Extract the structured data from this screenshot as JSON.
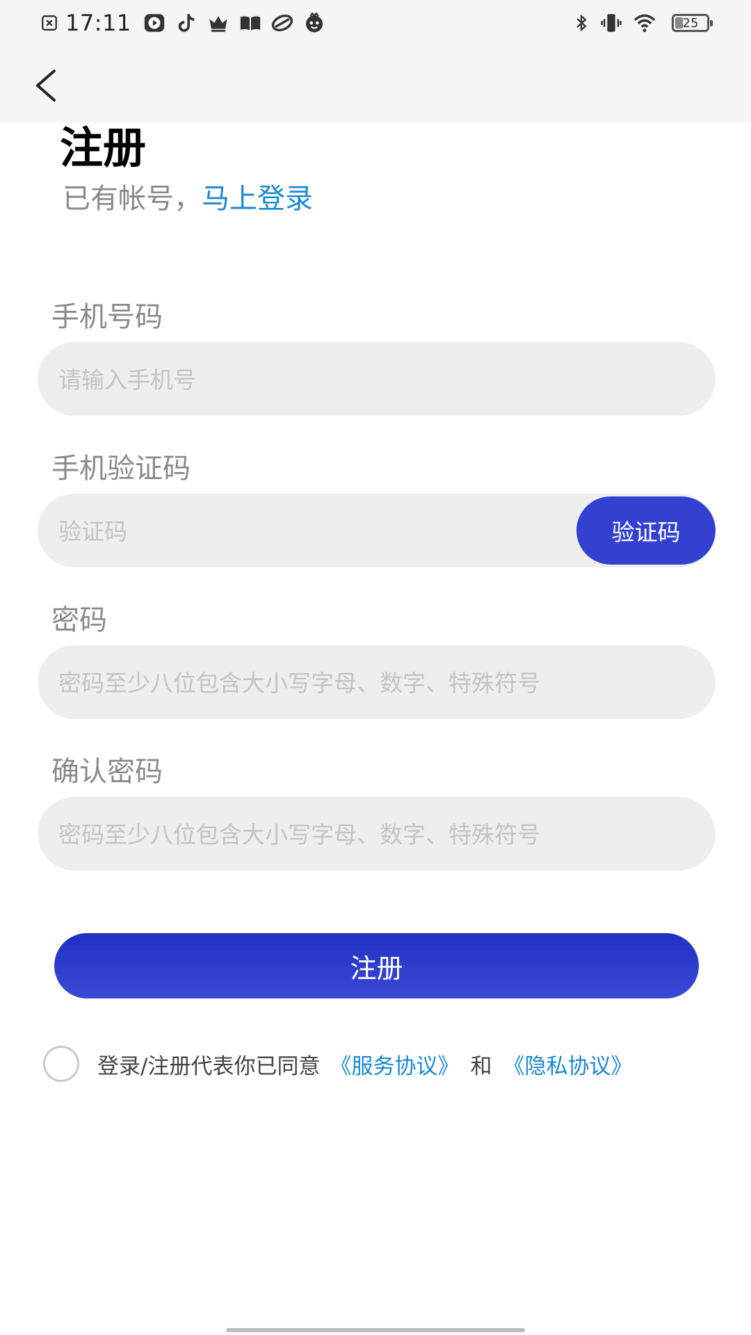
{
  "status_bar": {
    "time": "17:11",
    "battery_level": "25",
    "left_icons": [
      "close-box-icon",
      "play-icon",
      "tiktok-icon",
      "crown-icon",
      "book-icon",
      "leaf-icon",
      "face-icon"
    ],
    "right_icons": [
      "bluetooth-icon",
      "vibrate-icon",
      "wifi-icon",
      "battery-icon"
    ]
  },
  "header": {
    "back_icon": "chevron-left-icon"
  },
  "page": {
    "title": "注册",
    "login_prompt": "已有帐号，",
    "login_link": "马上登录"
  },
  "form": {
    "phone": {
      "label": "手机号码",
      "value": "",
      "placeholder": "请输入手机号"
    },
    "code": {
      "label": "手机验证码",
      "value": "",
      "placeholder": "验证码",
      "button_label": "验证码"
    },
    "password": {
      "label": "密码",
      "value": "",
      "placeholder": "密码至少八位包含大小写字母、数字、特殊符号"
    },
    "confirm_password": {
      "label": "确认密码",
      "value": "",
      "placeholder": "密码至少八位包含大小写字母、数字、特殊符号"
    },
    "submit_label": "注册"
  },
  "agreement": {
    "checked": false,
    "text": "登录/注册代表你已同意",
    "service_link": "《服务协议》",
    "conjunction": "和",
    "privacy_link": "《隐私协议》"
  },
  "colors": {
    "accent": "#3340d0",
    "link": "#1a88d0",
    "input_bg": "#eeeeee",
    "header_bg": "#f5f5f5"
  }
}
